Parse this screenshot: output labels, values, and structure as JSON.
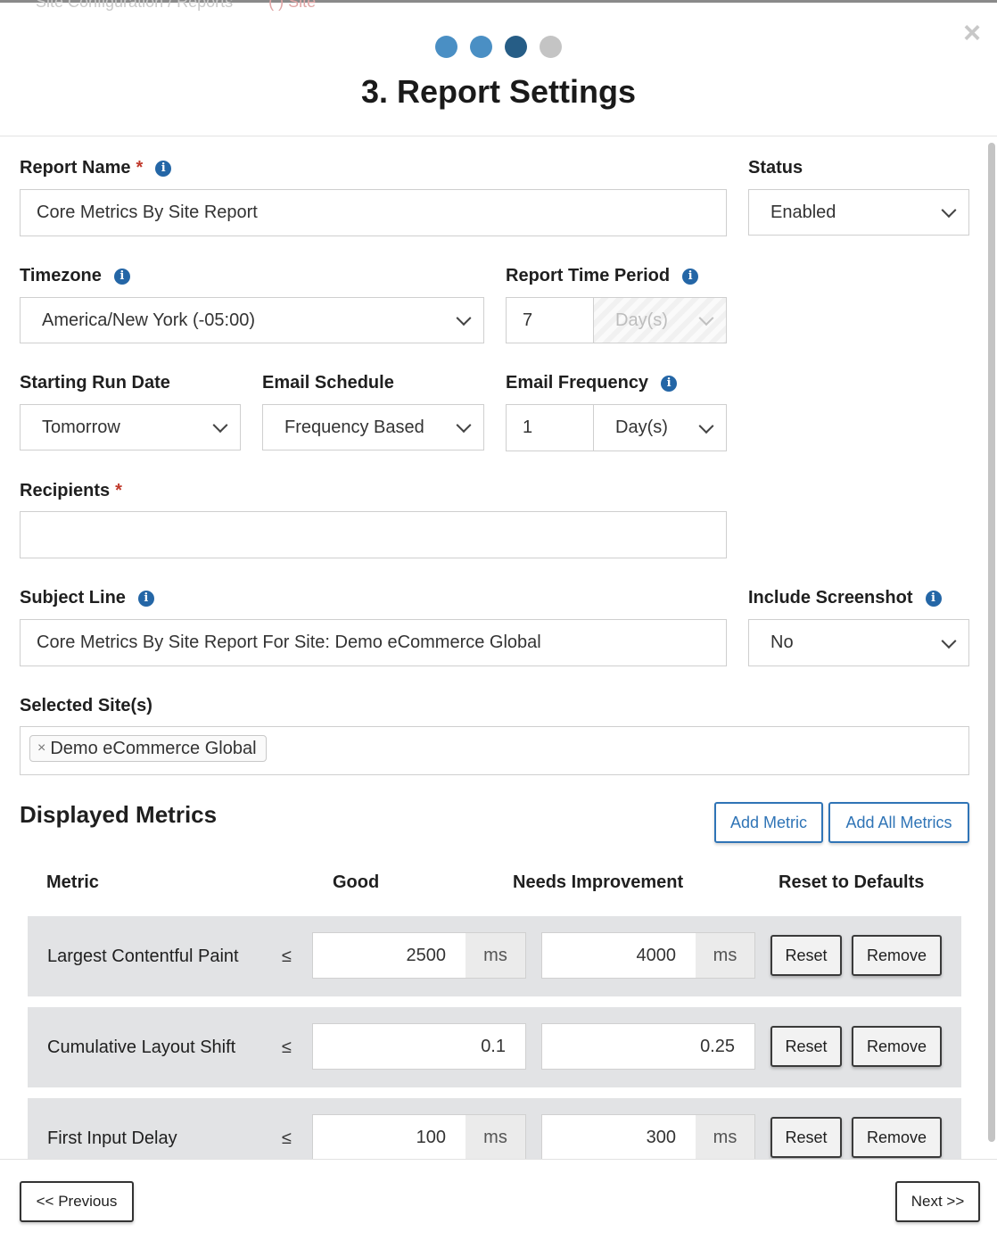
{
  "background_header": {
    "ghost_text": "Site Configuration / Reports",
    "ghost_accent": "( ) Site"
  },
  "wizard": {
    "steps": [
      {
        "state": "complete",
        "color": "#4a8fc4"
      },
      {
        "state": "complete",
        "color": "#4a8fc4"
      },
      {
        "state": "current",
        "color": "#265d86"
      },
      {
        "state": "upcoming",
        "color": "#c4c4c4"
      }
    ],
    "title": "3. Report Settings",
    "close_icon": "×"
  },
  "form": {
    "report_name": {
      "label": "Report Name",
      "required_mark": "*",
      "value": "Core Metrics By Site Report"
    },
    "status": {
      "label": "Status",
      "value": "Enabled"
    },
    "timezone": {
      "label": "Timezone",
      "value": "America/New York (-05:00)"
    },
    "report_time_period": {
      "label": "Report Time Period",
      "value": "7",
      "unit": "Day(s)"
    },
    "starting_run_date": {
      "label": "Starting Run Date",
      "value": "Tomorrow"
    },
    "email_schedule": {
      "label": "Email Schedule",
      "value": "Frequency Based"
    },
    "email_frequency": {
      "label": "Email Frequency",
      "value": "1",
      "unit": "Day(s)"
    },
    "recipients": {
      "label": "Recipients",
      "required_mark": "*",
      "value": ""
    },
    "subject_line": {
      "label": "Subject Line",
      "value": "Core Metrics By Site Report For Site: Demo eCommerce Global"
    },
    "include_screenshot": {
      "label": "Include Screenshot",
      "value": "No"
    },
    "selected_sites": {
      "label": "Selected Site(s)",
      "tags": [
        "Demo eCommerce Global"
      ],
      "remove_glyph": "×"
    }
  },
  "metrics": {
    "title": "Displayed Metrics",
    "add_metric_label": "Add Metric",
    "add_all_label": "Add All Metrics",
    "columns": [
      "Metric",
      "Good",
      "Needs Improvement",
      "Reset to Defaults"
    ],
    "comparator": "≤",
    "reset_label": "Reset",
    "remove_label": "Remove",
    "rows": [
      {
        "name": "Largest Contentful Paint",
        "good": "2500",
        "needs_improvement": "4000",
        "unit": "ms"
      },
      {
        "name": "Cumulative Layout Shift",
        "good": "0.1",
        "needs_improvement": "0.25",
        "unit": ""
      },
      {
        "name": "First Input Delay",
        "good": "100",
        "needs_improvement": "300",
        "unit": "ms"
      }
    ]
  },
  "footer": {
    "previous_label": "<< Previous",
    "next_label": "Next >>"
  }
}
